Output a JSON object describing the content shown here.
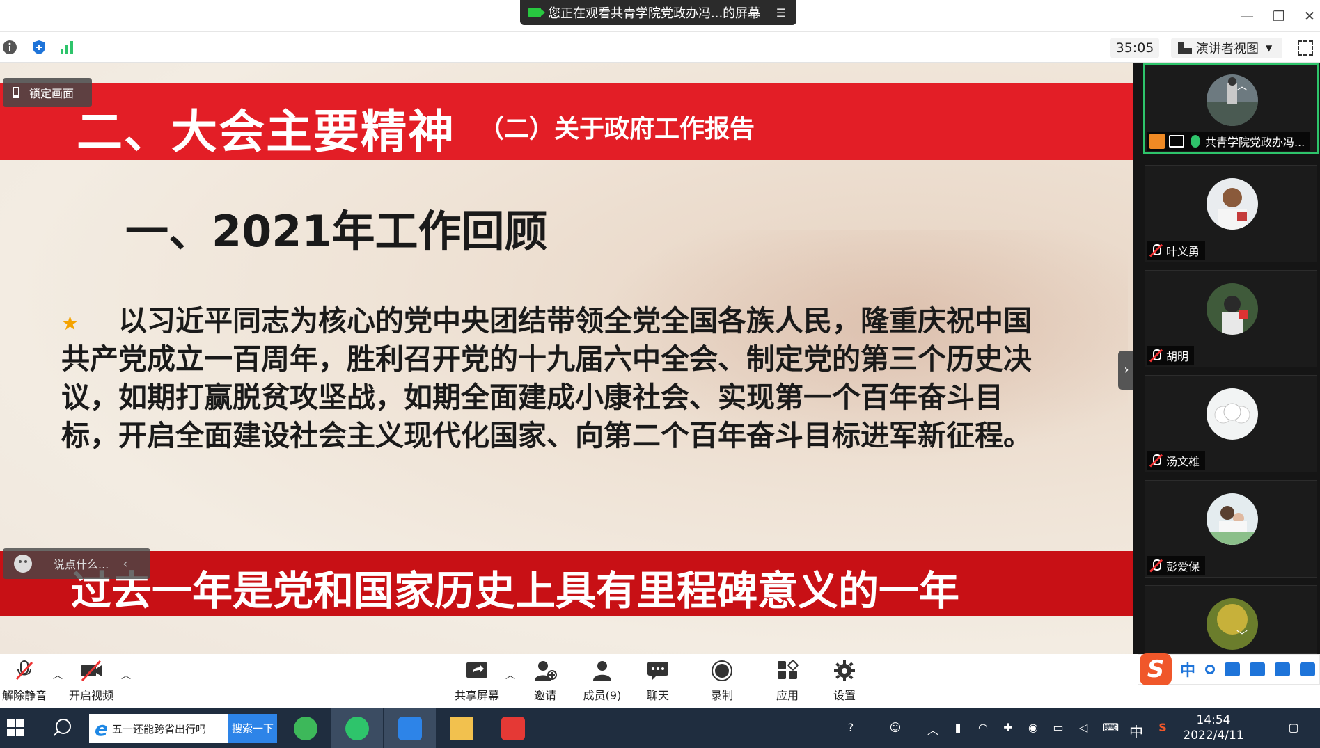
{
  "window": {
    "title": "您正在观看共青学院党政办冯...的屏幕"
  },
  "toolbar": {
    "timer": "35:05",
    "view_mode": "演讲者视图"
  },
  "slide": {
    "title_main": "二、大会主要精神",
    "title_sub": "（二）关于政府工作报告",
    "heading": "一、2021年工作回顾",
    "body": "以习近平同志为核心的党中央团结带领全党全国各族人民，隆重庆祝中国共产党成立一百周年，胜利召开党的十九届六中全会、制定党的第三个历史决议，如期打赢脱贫攻坚战，如期全面建成小康社会、实现第一个百年奋斗目标，开启全面建设社会主义现代化国家、向第二个百年奋斗目标进军新征程。",
    "banner": "过去一年是党和国家历史上具有里程碑意义的一年"
  },
  "overlay": {
    "lock_label": "锁定画面",
    "chat_placeholder": "说点什么..."
  },
  "participants": [
    {
      "name": "共青学院党政办冯...",
      "active": true
    },
    {
      "name": "叶义勇"
    },
    {
      "name": "胡明"
    },
    {
      "name": "汤文雄"
    },
    {
      "name": "彭爱保"
    }
  ],
  "meeting_controls": {
    "unmute": "解除静音",
    "start_video": "开启视频",
    "share": "共享屏幕",
    "invite": "邀请",
    "members": "成员(9)",
    "chat": "聊天",
    "record": "录制",
    "apps": "应用",
    "settings": "设置"
  },
  "ime": {
    "mode": "中"
  },
  "taskbar": {
    "search_text": "五一还能跨省出行吗",
    "search_button": "搜索一下",
    "ime": "中",
    "time": "14:54",
    "date": "2022/4/11"
  },
  "colors": {
    "slide_red": "#e31e26",
    "active_green": "#2ec46b",
    "taskbar": "#1f2d3f"
  }
}
